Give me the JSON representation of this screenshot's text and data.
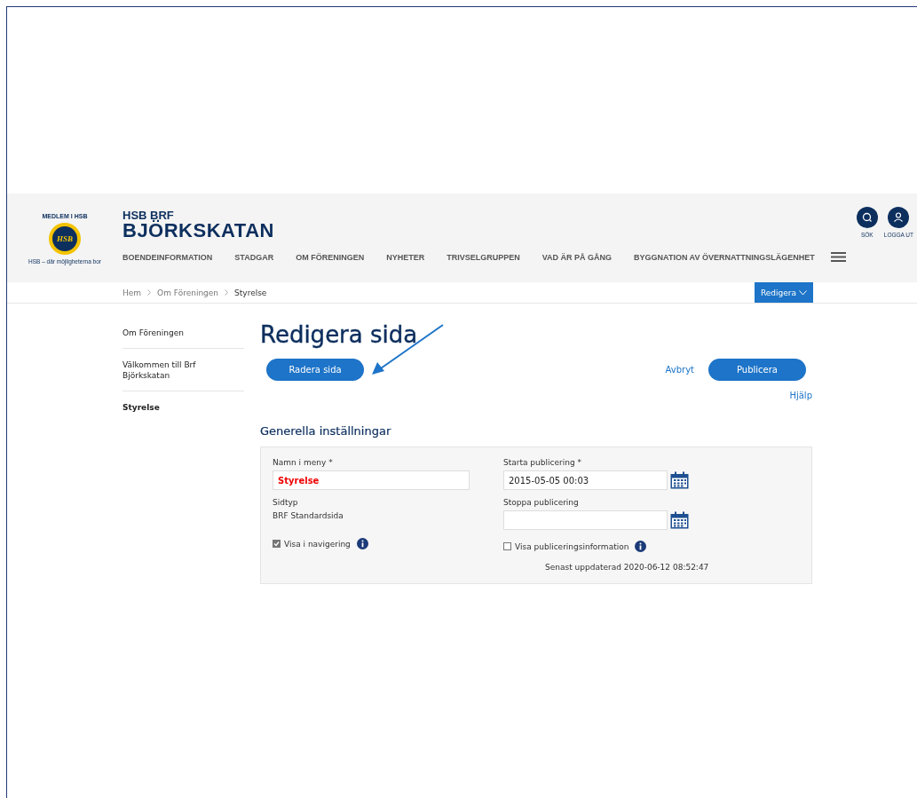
{
  "logo": {
    "top_text": "MEDLEM I HSB",
    "emblem_text": "HSB",
    "tagline": "HSB – där möjligheterna bor"
  },
  "site": {
    "line1": "HSB BRF",
    "line2": "BJÖRKSKATAN"
  },
  "nav": [
    "BOENDEINFORMATION",
    "STADGAR",
    "OM FÖRENINGEN",
    "NYHETER",
    "TRIVSELGRUPPEN",
    "VAD ÄR PÅ GÅNG",
    "BYGGNATION AV ÖVERNATTNINGSLÄGENHET"
  ],
  "header_actions": [
    {
      "label": "SÖK",
      "kind": "search"
    },
    {
      "label": "LOGGA UT",
      "kind": "user"
    }
  ],
  "breadcrumb": [
    "Hem",
    "Om Föreningen",
    "Styrelse"
  ],
  "edit_menu": {
    "label": "Redigera"
  },
  "sidebar": [
    {
      "label": "Om Föreningen",
      "selected": false
    },
    {
      "label": "Välkommen till Brf Björkskatan",
      "selected": false
    },
    {
      "label": "Styrelse",
      "selected": true
    }
  ],
  "page_title": "Redigera sida",
  "actions": {
    "delete": "Radera sida",
    "cancel": "Avbryt",
    "publish": "Publicera",
    "help": "Hjälp"
  },
  "section_title": "Generella inställningar",
  "form": {
    "name_label": "Namn i meny *",
    "name_value": "Styrelse",
    "page_type_label": "Sidtyp",
    "page_type_value": "BRF Standardsida",
    "start_label": "Starta publicering *",
    "start_value": "2015-05-05 00:03",
    "stop_label": "Stoppa publicering",
    "show_in_nav": {
      "label": "Visa i navigering",
      "checked": true
    },
    "show_pub_info": {
      "label": "Visa publiceringsinformation",
      "checked": false
    },
    "updated": "Senast uppdaterad 2020-06-12 08:52:47"
  }
}
